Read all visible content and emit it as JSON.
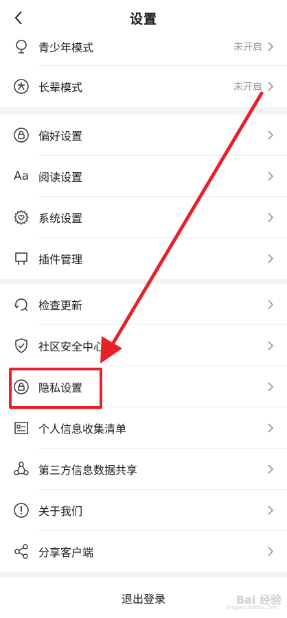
{
  "header": {
    "title": "设置"
  },
  "group1": [
    {
      "label": "青少年模式",
      "status": "未开启",
      "icon": "teen-mode-icon"
    },
    {
      "label": "长辈模式",
      "status": "未开启",
      "icon": "elder-mode-icon"
    }
  ],
  "group2": [
    {
      "label": "偏好设置",
      "icon": "lock-icon"
    },
    {
      "label": "阅读设置",
      "icon": "font-aa-icon",
      "icon_text": "Aa"
    },
    {
      "label": "系统设置",
      "icon": "gear-heart-icon"
    },
    {
      "label": "插件管理",
      "icon": "plugin-board-icon"
    }
  ],
  "group3": [
    {
      "label": "检查更新",
      "icon": "update-arrow-icon"
    },
    {
      "label": "社区安全中心",
      "icon": "shield-check-icon"
    },
    {
      "label": "隐私设置",
      "icon": "privacy-lock-icon"
    },
    {
      "label": "个人信息收集清单",
      "icon": "id-card-icon"
    },
    {
      "label": "第三方信息数据共享",
      "icon": "share-network-icon"
    },
    {
      "label": "关于我们",
      "icon": "info-exclamation-icon"
    },
    {
      "label": "分享客户端",
      "icon": "share-icon"
    }
  ],
  "logout": {
    "label": "退出登录"
  },
  "watermark": {
    "text": "Bai 经验",
    "sub": "jingyan.baidu.com"
  },
  "colors": {
    "highlight": "#e8202a",
    "separator": "#f4f4f4"
  }
}
